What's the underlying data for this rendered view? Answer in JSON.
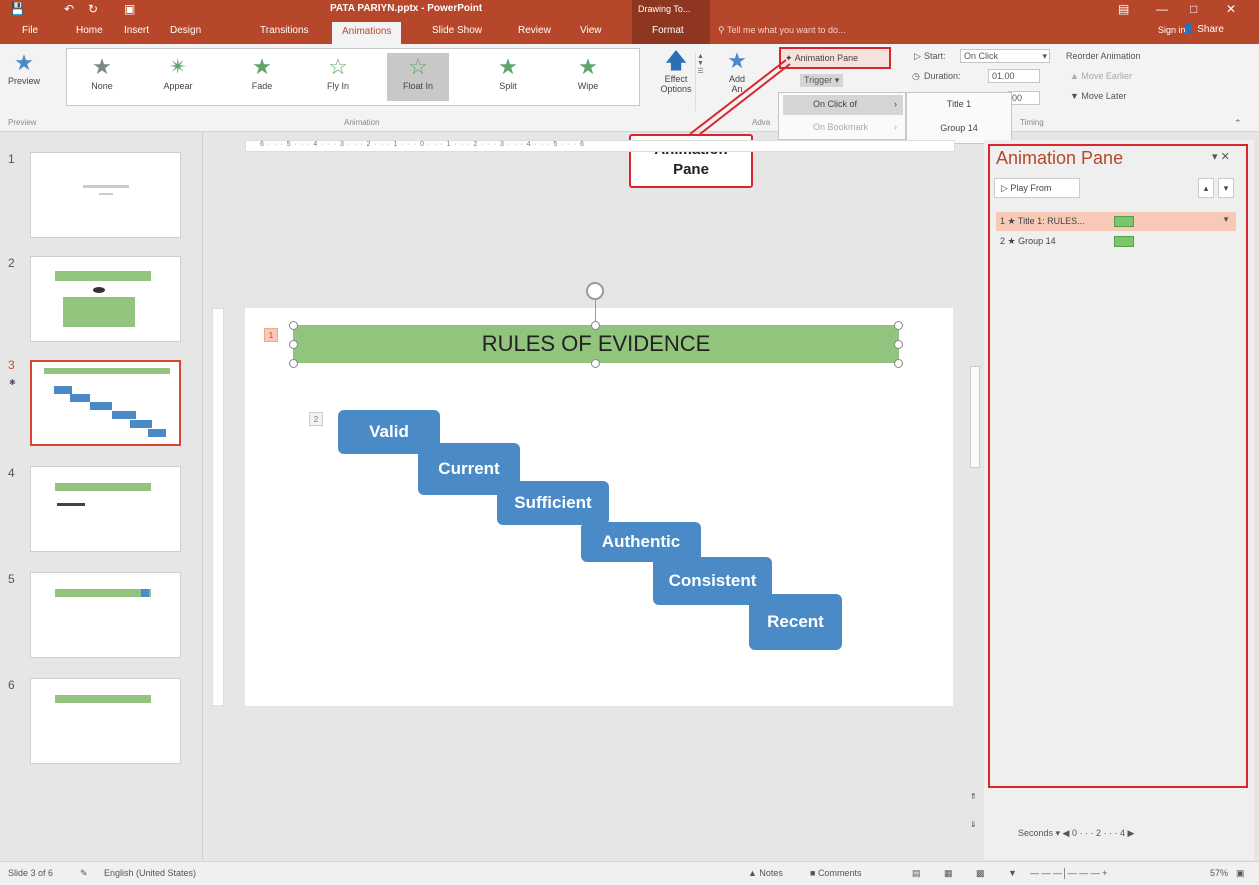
{
  "window": {
    "title": "PATA PARIYN.pptx - PowerPoint",
    "contextual_group": "Drawing To...",
    "quick_access_icons": [
      "save-icon",
      "undo-icon",
      "redo-icon",
      "start-from-beginning-icon"
    ]
  },
  "tabs": [
    {
      "label": "File"
    },
    {
      "label": "Home"
    },
    {
      "label": "Insert"
    },
    {
      "label": "Design"
    },
    {
      "label": "Transitions"
    },
    {
      "label": "Animations"
    },
    {
      "label": "Slide Show"
    },
    {
      "label": "Review"
    },
    {
      "label": "View"
    },
    {
      "label": "Format"
    }
  ],
  "tell_me": "Tell me what you want to do...",
  "sign_in": "Sign in",
  "share": "Share",
  "ribbon": {
    "preview_label": "Preview",
    "preview_group": "Preview",
    "animation_group": "Animation",
    "advanced_group": "Adva",
    "timing_group": "Timing",
    "gallery": [
      {
        "label": "None"
      },
      {
        "label": "Appear"
      },
      {
        "label": "Fade"
      },
      {
        "label": "Fly In"
      },
      {
        "label": "Float In"
      },
      {
        "label": "Split"
      },
      {
        "label": "Wipe"
      }
    ],
    "effect_options": "Effect Options",
    "add_animation": "Add Animation",
    "add_animation_top": "Add",
    "add_animation_bottom": "An",
    "animation_pane_button": "Animation Pane",
    "trigger": "Trigger",
    "start_label": "Start:",
    "start_value": "On Click",
    "duration_label": "Duration:",
    "duration_value": "01.00",
    "delay_value": "00",
    "reorder": "Reorder Animation",
    "move_earlier": "Move Earlier",
    "move_later": "Move Later"
  },
  "trigger_menu": {
    "items": [
      {
        "label": "On Click of"
      },
      {
        "label": "On Bookmark"
      }
    ],
    "submenu": [
      {
        "label": "Title 1"
      },
      {
        "label": "Group 14"
      }
    ]
  },
  "callout": {
    "line1": "Animation",
    "line2": "Pane"
  },
  "thumbnails": [
    {
      "num": "1"
    },
    {
      "num": "2"
    },
    {
      "num": "3"
    },
    {
      "num": "4"
    },
    {
      "num": "5"
    },
    {
      "num": "6"
    }
  ],
  "ruler_text": "6 · · · 5 · · · 4 · · · 3 · · · 2 · · · 1 · · · 0 · · · 1 · · · 2 · · · 3 · · · 4 · · · 5 · · · 6",
  "slide": {
    "title": "RULES OF EVIDENCE",
    "title_tag": "1",
    "group_tag": "2",
    "steps": [
      "Valid",
      "Current",
      "Sufficient",
      "Authentic",
      "Consistent",
      "Recent"
    ]
  },
  "animation_pane": {
    "title": "Animation Pane",
    "play_from": "Play From",
    "items": [
      {
        "label": "1 ★ Title 1: RULES..."
      },
      {
        "label": "2 ★ Group 14"
      }
    ],
    "seconds_label": "Seconds",
    "timeline": "0 · · · 2 · · · 4"
  },
  "status": {
    "slide_info": "Slide 3 of 6",
    "language": "English (United States)",
    "notes": "Notes",
    "comments": "Comments",
    "zoom": "57%"
  }
}
